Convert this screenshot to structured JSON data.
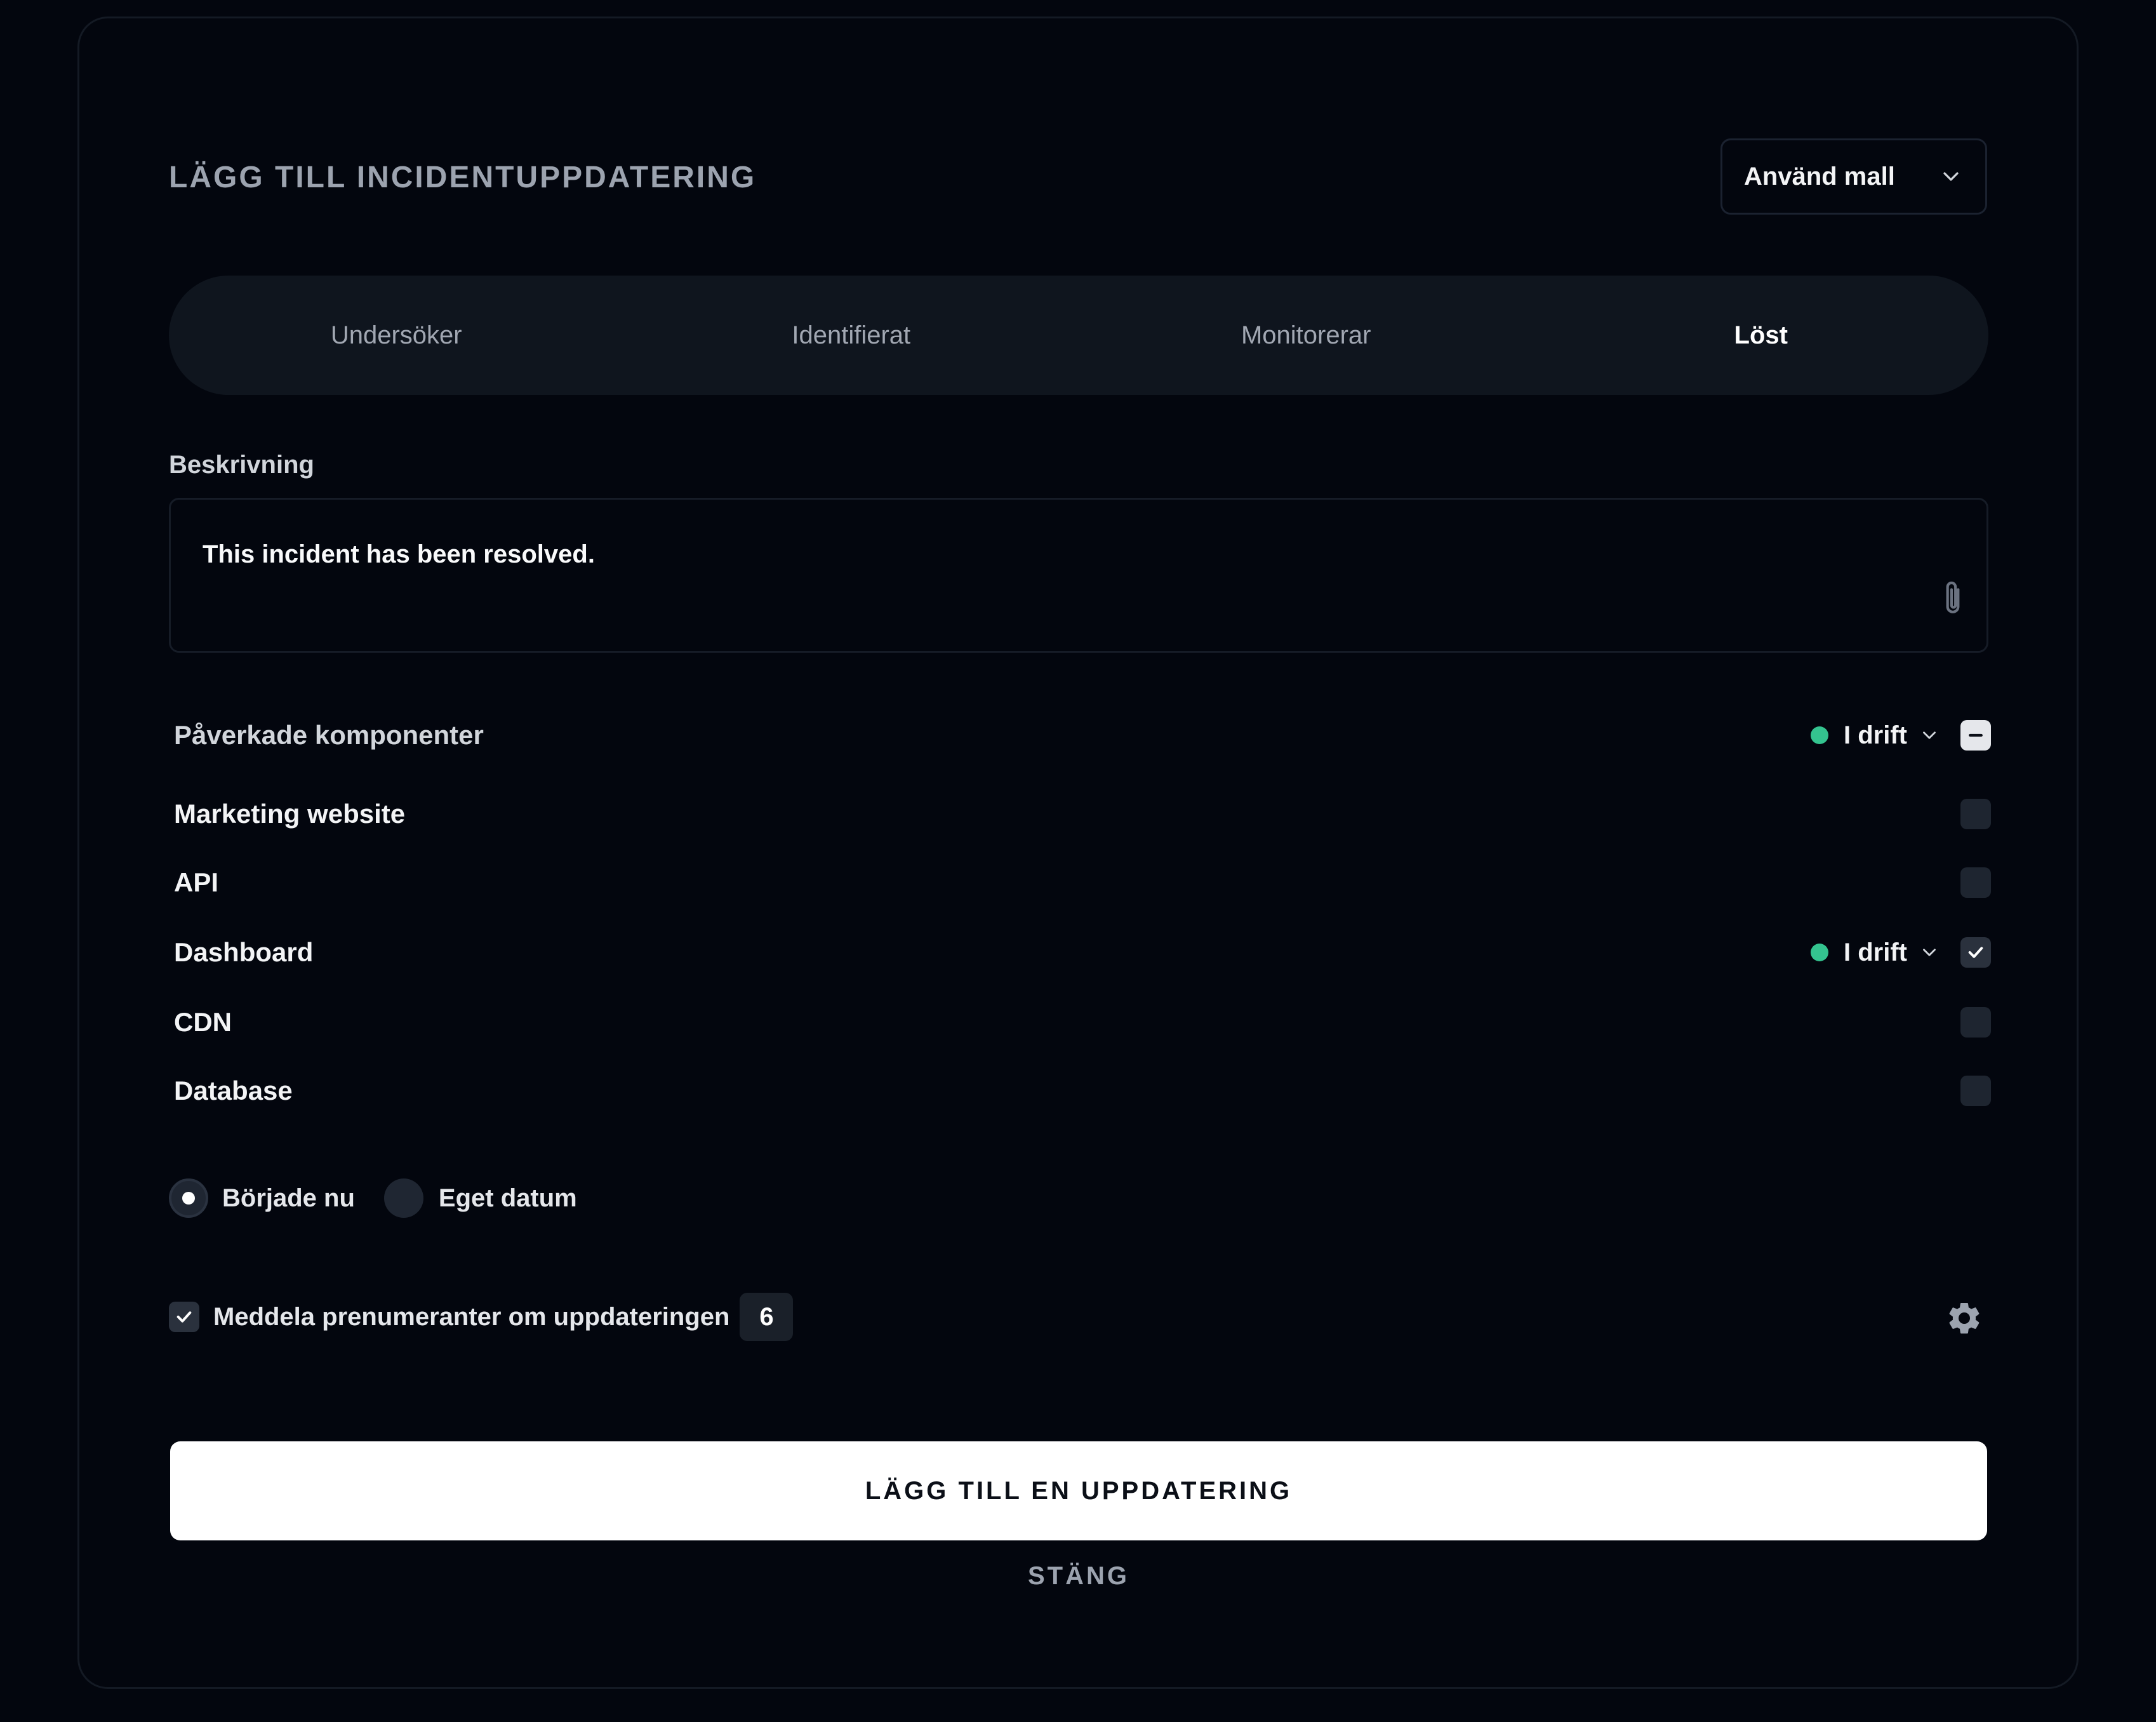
{
  "header": {
    "title": "LÄGG TILL INCIDENTUPPDATERING",
    "template_select": {
      "selected": "Använd mall",
      "icon": "chevron-down-icon"
    }
  },
  "tabs": [
    {
      "label": "Undersöker",
      "active": false
    },
    {
      "label": "Identifierat",
      "active": false
    },
    {
      "label": "Monitorerar",
      "active": false
    },
    {
      "label": "Löst",
      "active": true
    }
  ],
  "description": {
    "label": "Beskrivning",
    "value": "This incident has been resolved.",
    "attach_icon": "paperclip-icon"
  },
  "components": {
    "header_label": "Påverkade komponenter",
    "bulk_status": "I drift",
    "bulk_checkbox_state": "indeterminate",
    "status_color": "#34c38f",
    "items": [
      {
        "name": "Marketing website",
        "checked": false,
        "status": ""
      },
      {
        "name": "API",
        "checked": false,
        "status": ""
      },
      {
        "name": "Dashboard",
        "checked": true,
        "status": "I drift"
      },
      {
        "name": "CDN",
        "checked": false,
        "status": ""
      },
      {
        "name": "Database",
        "checked": false,
        "status": ""
      }
    ]
  },
  "start_time": {
    "options": [
      {
        "label": "Började nu",
        "selected": true
      },
      {
        "label": "Eget datum",
        "selected": false
      }
    ]
  },
  "notify": {
    "label": "Meddela prenumeranter om uppdateringen",
    "checked": true,
    "count": "6",
    "settings_icon": "gear-icon"
  },
  "actions": {
    "primary_label": "LÄGG TILL EN UPPDATERING",
    "close_label": "STÄNG"
  }
}
